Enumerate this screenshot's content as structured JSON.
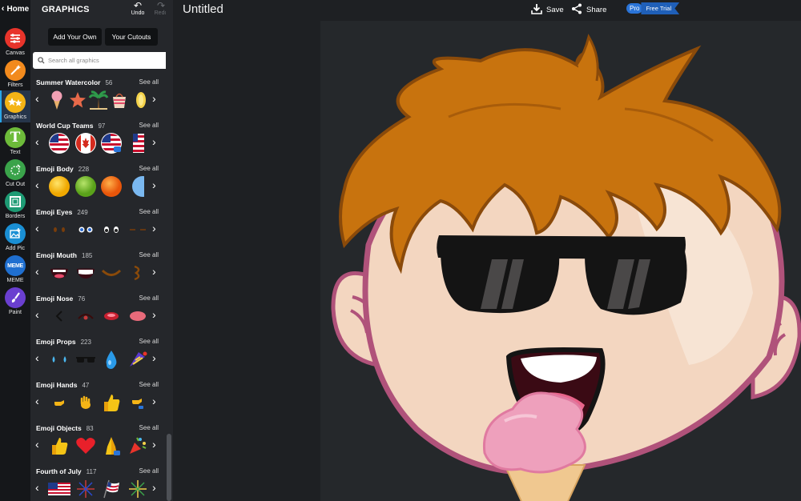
{
  "rail": {
    "home_label": "Home",
    "tools": [
      {
        "label": "Canvas",
        "icon": "sliders-icon",
        "color": "#e8342b"
      },
      {
        "label": "Filters",
        "icon": "magic-wand-icon",
        "color": "#f28a1d"
      },
      {
        "label": "Graphics",
        "icon": "stars-icon",
        "color": "#f4b416"
      },
      {
        "label": "Text",
        "icon": "text-t-icon",
        "color": "#6dbb3a"
      },
      {
        "label": "Cut Out",
        "icon": "cutout-icon",
        "color": "#3aa34a"
      },
      {
        "label": "Borders",
        "icon": "border-frame-icon",
        "color": "#1e9b74"
      },
      {
        "label": "Add Pic",
        "icon": "add-picture-icon",
        "color": "#1a8fd4"
      },
      {
        "label": "MEME",
        "icon": "meme-icon",
        "color": "#1f6fd0"
      },
      {
        "label": "Paint",
        "icon": "paintbrush-icon",
        "color": "#6a3fd0"
      }
    ]
  },
  "panel": {
    "title": "GRAPHICS",
    "undo_label": "Undo",
    "redo_label": "Redo",
    "add_own_label": "Add Your Own",
    "cutouts_label": "Your Cutouts",
    "search_placeholder": "Search all graphics",
    "see_all": "See all",
    "sections": [
      {
        "title": "Summer Watercolor",
        "count": "56",
        "thumbs": [
          "🍦",
          "⭐",
          "🌴",
          "👙",
          "🍋"
        ]
      },
      {
        "title": "World Cup Teams",
        "count": "97",
        "thumbs": [
          "🇺🇸",
          "🇨🇦",
          "🇺🇸",
          "🇺🇸"
        ]
      },
      {
        "title": "Emoji Body",
        "count": "228",
        "thumbs": [
          "🟡",
          "🟢",
          "🟠",
          "🔵"
        ]
      },
      {
        "title": "Emoji Eyes",
        "count": "249",
        "thumbs": [
          "••",
          "👀",
          "👁",
          "─"
        ]
      },
      {
        "title": "Emoji Mouth",
        "count": "185",
        "thumbs": [
          "👄",
          "😁",
          "︶",
          "3"
        ]
      },
      {
        "title": "Emoji Nose",
        "count": "76",
        "thumbs": [
          "<",
          "⌒",
          "👃",
          "◖"
        ]
      },
      {
        "title": "Emoji Props",
        "count": "223",
        "thumbs": [
          "💧",
          "🕶",
          "💧",
          "🎉"
        ]
      },
      {
        "title": "Emoji Hands",
        "count": "47",
        "thumbs": [
          "👉",
          "👋",
          "👍",
          "👉"
        ]
      },
      {
        "title": "Emoji Objects",
        "count": "83",
        "thumbs": [
          "👍",
          "❤️",
          "🙏",
          "🎉"
        ]
      },
      {
        "title": "Fourth of July",
        "count": "117",
        "thumbs": [
          "🇺🇸",
          "🎆",
          "🇺🇸",
          "🎆"
        ]
      }
    ]
  },
  "topbar": {
    "title": "Untitled",
    "save_label": "Save",
    "share_label": "Share",
    "pro_label": "Pro",
    "trial_label": "Free Trial"
  },
  "colors": {
    "accent": "#2aa6e8",
    "hair": "#c8730e",
    "skin": "#f6dcc6",
    "outline": "#7a3d1a"
  }
}
